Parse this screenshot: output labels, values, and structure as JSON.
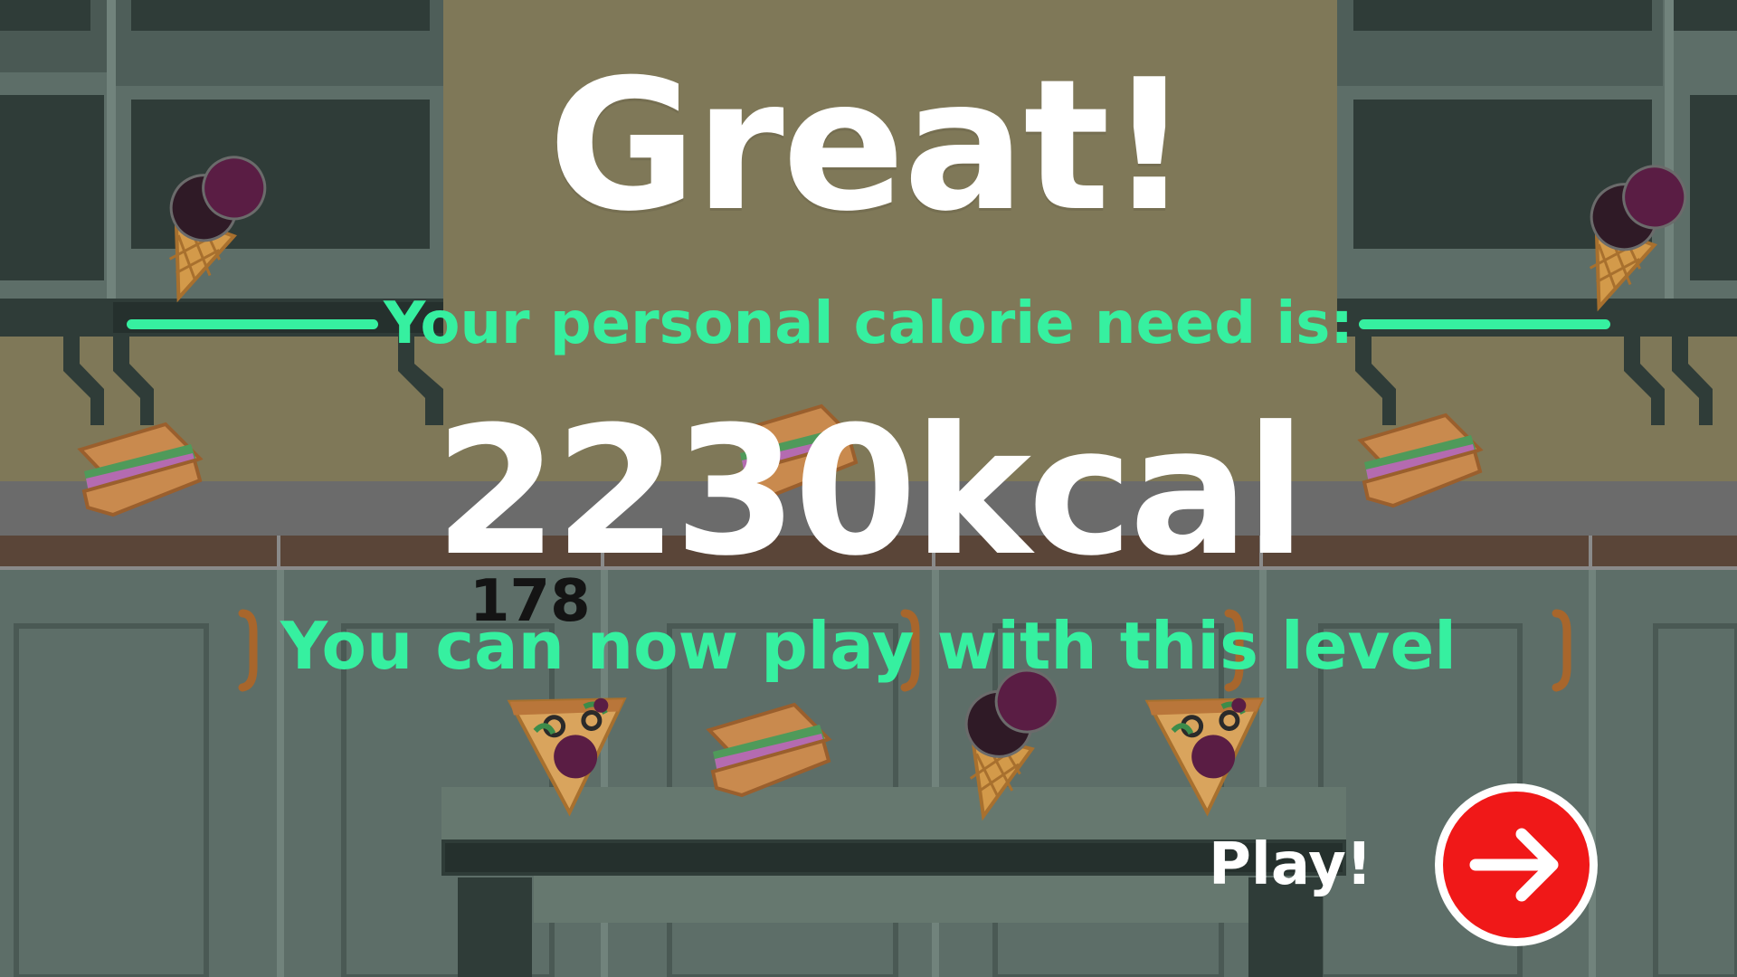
{
  "result": {
    "title": "Great!",
    "need_label": "Your personal calorie need is:",
    "calorie_value": "2230kcal",
    "counter": "178",
    "unlock_message": "You can now play with this level"
  },
  "actions": {
    "play_label": "Play!",
    "play_icon": "arrow-right-icon"
  },
  "colors": {
    "accent": "#36f0a0",
    "play_button": "#f01818",
    "wall": "#7f7858",
    "cabinet": "#5d6e68"
  },
  "food_items": [
    "ice-cream",
    "ice-cream",
    "sandwich",
    "sandwich",
    "sandwich",
    "pizza-slice",
    "sandwich",
    "ice-cream",
    "pizza-slice"
  ]
}
